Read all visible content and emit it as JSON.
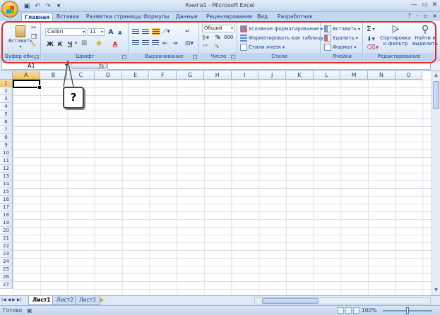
{
  "window": {
    "title": "Книга1 - Microsoft Excel"
  },
  "tabs": [
    "Главная",
    "Вставка",
    "Разметка страницы",
    "Формулы",
    "Данные",
    "Рецензирование",
    "Вид",
    "Разработчик"
  ],
  "ribbon": {
    "clipboard": {
      "label": "Буфер обм...",
      "paste": "Вставить"
    },
    "font": {
      "label": "Шрифт",
      "font_name": "Calibri",
      "font_size": "11",
      "bold": "Ж",
      "italic": "К",
      "underline": "Ч",
      "grow": "A",
      "shrink": "A",
      "color_letter": "A"
    },
    "alignment": {
      "label": "Выравнивание"
    },
    "number": {
      "label": "Число",
      "format": "Общий",
      "percent": "%",
      "thousands": "000"
    },
    "styles": {
      "label": "Стили",
      "conditional": "Условное форматирование",
      "table": "Форматировать как таблицу",
      "cell_styles": "Стили ячеек"
    },
    "cells": {
      "label": "Ячейки",
      "insert": "Вставить",
      "delete": "Удалить",
      "format": "Формат"
    },
    "editing": {
      "label": "Редактирование",
      "sort_line1": "Сортировка",
      "sort_line2": "и фильтр",
      "find_line1": "Найти и",
      "find_line2": "выделить",
      "sum": "Σ"
    }
  },
  "formula_bar": {
    "name_box": "A1",
    "fx": "fx",
    "value": ""
  },
  "grid": {
    "columns": [
      "A",
      "B",
      "C",
      "D",
      "E",
      "F",
      "G",
      "H",
      "I",
      "J",
      "K",
      "L",
      "M",
      "N",
      "O"
    ],
    "rows": [
      "1",
      "2",
      "3",
      "4",
      "5",
      "6",
      "7",
      "8",
      "9",
      "10",
      "11",
      "12",
      "13",
      "14",
      "15",
      "16",
      "17",
      "18",
      "19",
      "20",
      "21",
      "22",
      "23",
      "24",
      "25",
      "26",
      "27"
    ],
    "active_cell": "A1"
  },
  "callout": {
    "text": "?"
  },
  "sheets": [
    "Лист1",
    "Лист2",
    "Лист3"
  ],
  "status": {
    "text": "Готово",
    "zoom": "100%"
  }
}
